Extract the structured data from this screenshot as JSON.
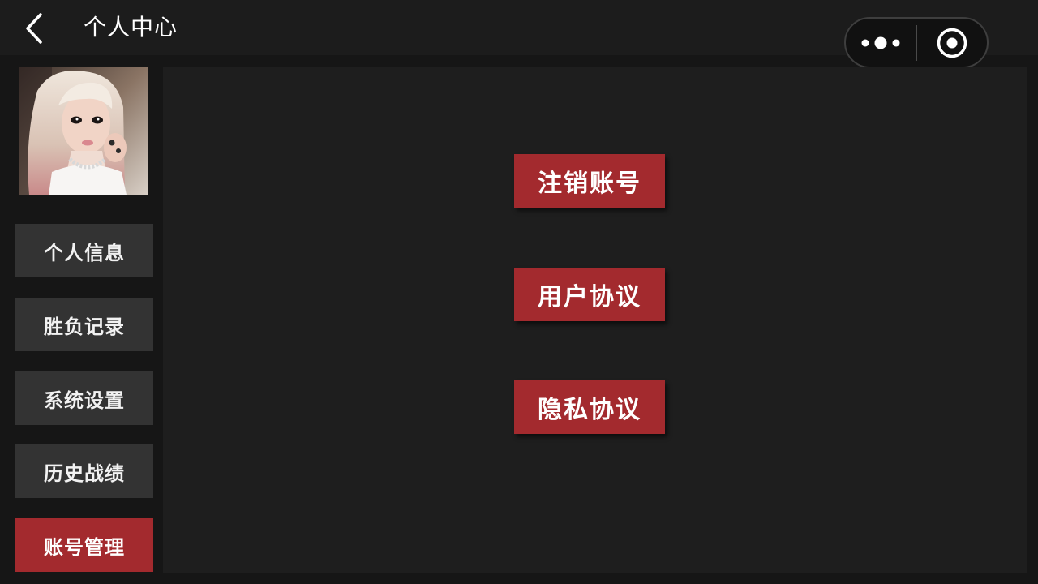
{
  "header": {
    "title": "个人中心",
    "back_icon": "chevron-left-icon",
    "capsule": {
      "more_icon": "more-dots-icon",
      "close_icon": "target-circle-icon"
    }
  },
  "colors": {
    "background": "#161616",
    "header": "#1c1c1c",
    "panel": "#1e1e1e",
    "sidebar_item": "#333333",
    "accent": "#a32a2e"
  },
  "sidebar": {
    "items": [
      {
        "label": "个人信息",
        "active": false
      },
      {
        "label": "胜负记录",
        "active": false
      },
      {
        "label": "系统设置",
        "active": false
      },
      {
        "label": "历史战绩",
        "active": false
      },
      {
        "label": "账号管理",
        "active": true
      }
    ]
  },
  "main": {
    "buttons": [
      {
        "label": "注销账号"
      },
      {
        "label": "用户协议"
      },
      {
        "label": "隐私协议"
      }
    ]
  }
}
